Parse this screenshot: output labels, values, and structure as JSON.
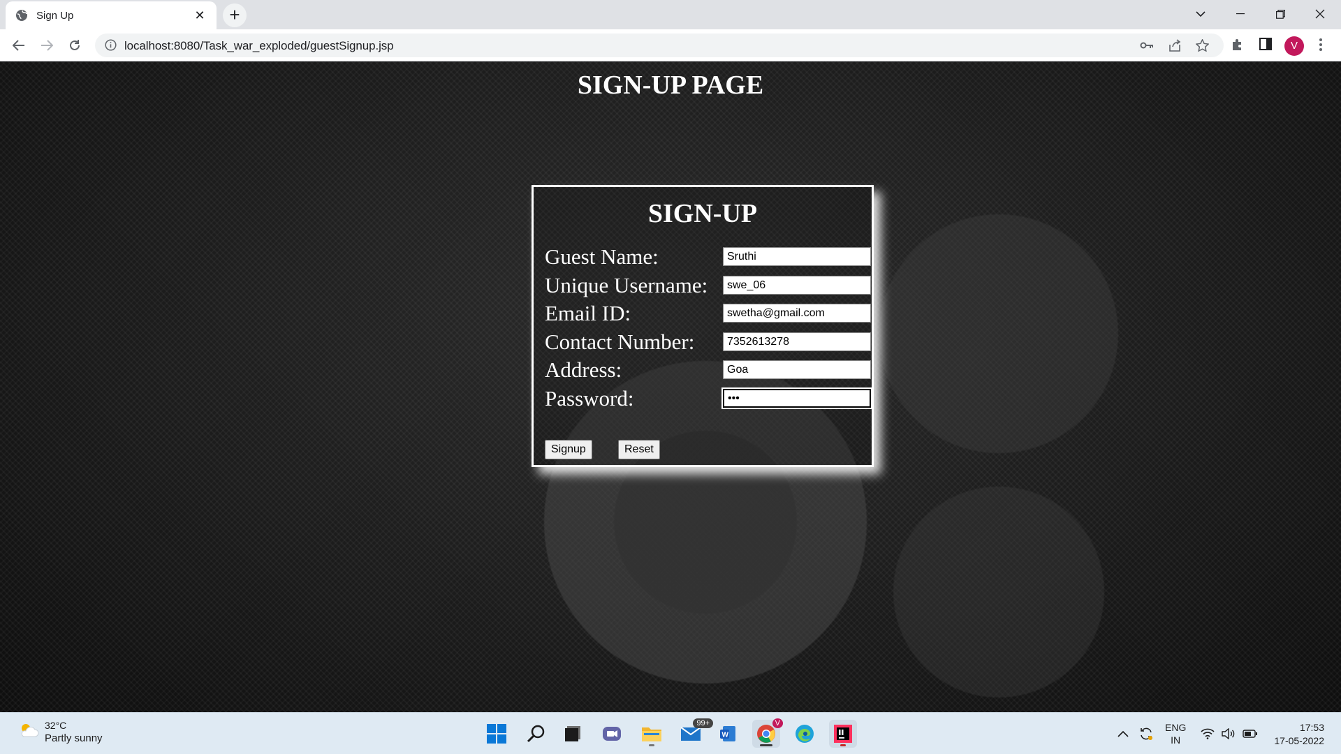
{
  "browser": {
    "tab_title": "Sign Up",
    "url": "localhost:8080/Task_war_exploded/guestSignup.jsp",
    "profile_initial": "V"
  },
  "page": {
    "title": "SIGN-UP PAGE",
    "form_title": "SIGN-UP",
    "fields": [
      {
        "label": "Guest Name:",
        "value": "Sruthi"
      },
      {
        "label": "Unique Username:",
        "value": "swe_06"
      },
      {
        "label": "Email ID:",
        "value": "swetha@gmail.com"
      },
      {
        "label": "Contact Number:",
        "value": "7352613278"
      },
      {
        "label": "Address:",
        "value": "Goa"
      },
      {
        "label": "Password:",
        "value": "•••"
      }
    ],
    "signup_label": "Signup",
    "reset_label": "Reset"
  },
  "taskbar": {
    "temperature": "32°C",
    "condition": "Partly sunny",
    "mail_badge": "99+",
    "chrome_badge": "V",
    "lang_line1": "ENG",
    "lang_line2": "IN",
    "time": "17:53",
    "date": "17-05-2022"
  }
}
